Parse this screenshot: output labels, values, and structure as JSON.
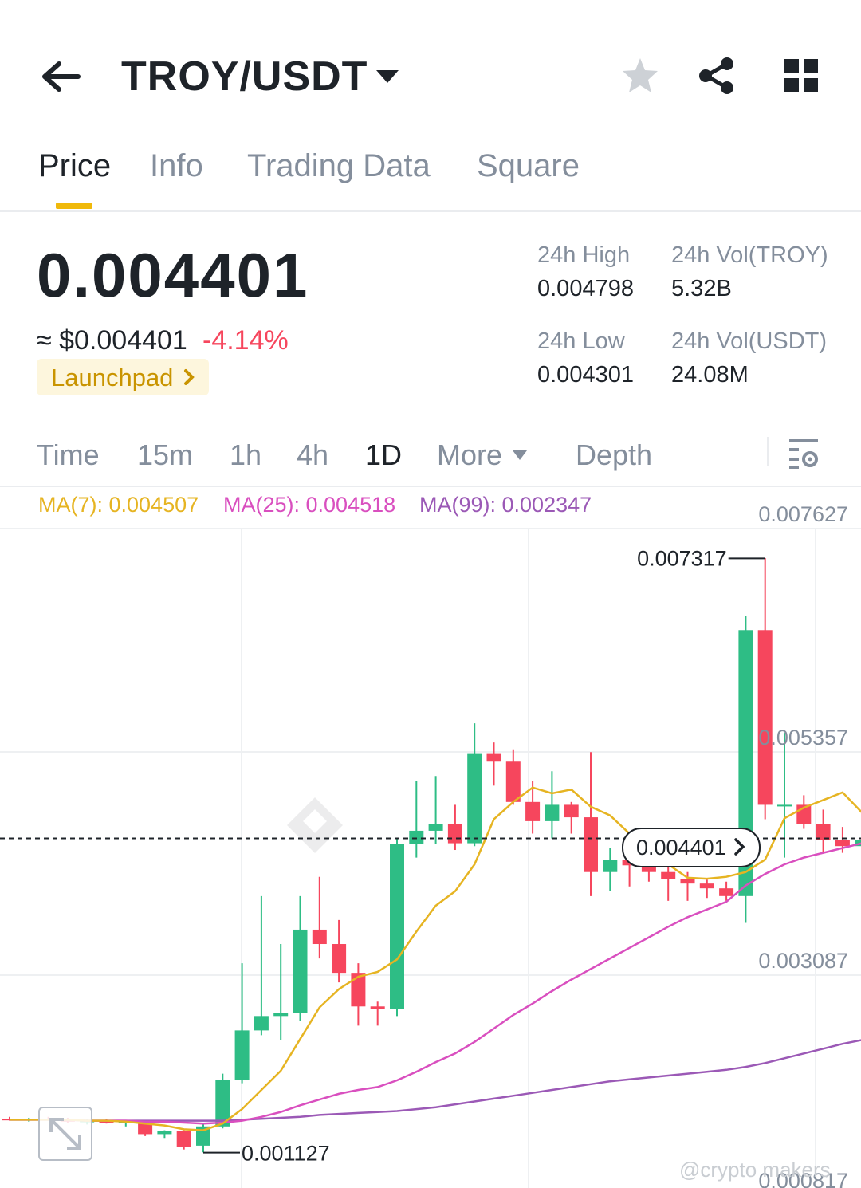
{
  "header": {
    "pair": "TROY/USDT",
    "icons": [
      "back-arrow-icon",
      "caret-down-icon",
      "star-icon",
      "share-icon",
      "grid-icon"
    ]
  },
  "tabs": [
    {
      "label": "Price",
      "active": true
    },
    {
      "label": "Info"
    },
    {
      "label": "Trading Data"
    },
    {
      "label": "Square"
    }
  ],
  "ticker": {
    "price": "0.004401",
    "approx": "≈ $0.004401",
    "change": "-4.14%",
    "badge": "Launchpad",
    "stats": [
      {
        "label": "24h High",
        "value": "0.004798"
      },
      {
        "label": "24h Vol(TROY)",
        "value": "5.32B"
      },
      {
        "label": "24h Low",
        "value": "0.004301"
      },
      {
        "label": "24h Vol(USDT)",
        "value": "24.08M"
      }
    ]
  },
  "intervals": [
    "Time",
    "15m",
    "1h",
    "4h",
    "1D",
    "More",
    "Depth"
  ],
  "active_interval": "1D",
  "ma": {
    "ma7": "MA(7): 0.004507",
    "ma25": "MA(25): 0.004518",
    "ma99": "MA(99): 0.002347"
  },
  "colors": {
    "up": "#2ebd85",
    "down": "#f6465d",
    "accent": "#f0b90b",
    "ma7": "#e6b422",
    "ma25": "#d94fbf",
    "ma99": "#9b59b6"
  },
  "chart_data": {
    "type": "candlestick",
    "interval": "1D",
    "y_axis_labels": [
      "0.007627",
      "0.005357",
      "0.003087",
      "0.000817"
    ],
    "ylim": [
      0.000817,
      0.007627
    ],
    "grid": true,
    "current_price_label": "0.004401",
    "high_annotation": "0.007317",
    "low_annotation": "0.001127",
    "candles": [
      {
        "o": 0.00148,
        "h": 0.0015,
        "l": 0.00146,
        "c": 0.00147
      },
      {
        "o": 0.00147,
        "h": 0.00149,
        "l": 0.00145,
        "c": 0.00148
      },
      {
        "o": 0.00148,
        "h": 0.0015,
        "l": 0.00146,
        "c": 0.00147
      },
      {
        "o": 0.00147,
        "h": 0.00149,
        "l": 0.00144,
        "c": 0.00145
      },
      {
        "o": 0.00145,
        "h": 0.00148,
        "l": 0.00142,
        "c": 0.00146
      },
      {
        "o": 0.00146,
        "h": 0.00148,
        "l": 0.00143,
        "c": 0.00144
      },
      {
        "o": 0.00144,
        "h": 0.00146,
        "l": 0.0014,
        "c": 0.00145
      },
      {
        "o": 0.00145,
        "h": 0.00146,
        "l": 0.0013,
        "c": 0.00132
      },
      {
        "o": 0.00132,
        "h": 0.00136,
        "l": 0.00128,
        "c": 0.00135
      },
      {
        "o": 0.00135,
        "h": 0.00136,
        "l": 0.00116,
        "c": 0.00119
      },
      {
        "o": 0.0012,
        "h": 0.00144,
        "l": 0.00113,
        "c": 0.0014
      },
      {
        "o": 0.0014,
        "h": 0.00195,
        "l": 0.00138,
        "c": 0.00188
      },
      {
        "o": 0.00188,
        "h": 0.0031,
        "l": 0.00185,
        "c": 0.0024
      },
      {
        "o": 0.0024,
        "h": 0.0038,
        "l": 0.00235,
        "c": 0.00255
      },
      {
        "o": 0.00255,
        "h": 0.0033,
        "l": 0.0023,
        "c": 0.00258
      },
      {
        "o": 0.00258,
        "h": 0.0038,
        "l": 0.0025,
        "c": 0.00345
      },
      {
        "o": 0.00345,
        "h": 0.004,
        "l": 0.00315,
        "c": 0.0033
      },
      {
        "o": 0.0033,
        "h": 0.00355,
        "l": 0.0029,
        "c": 0.003
      },
      {
        "o": 0.003,
        "h": 0.0031,
        "l": 0.00245,
        "c": 0.00265
      },
      {
        "o": 0.00265,
        "h": 0.0027,
        "l": 0.00245,
        "c": 0.00262
      },
      {
        "o": 0.00262,
        "h": 0.0044,
        "l": 0.00255,
        "c": 0.00434
      },
      {
        "o": 0.00434,
        "h": 0.005,
        "l": 0.0042,
        "c": 0.00448
      },
      {
        "o": 0.00448,
        "h": 0.00505,
        "l": 0.00434,
        "c": 0.00455
      },
      {
        "o": 0.00455,
        "h": 0.00475,
        "l": 0.00428,
        "c": 0.00435
      },
      {
        "o": 0.00435,
        "h": 0.0056,
        "l": 0.00432,
        "c": 0.00528
      },
      {
        "o": 0.00528,
        "h": 0.0054,
        "l": 0.00495,
        "c": 0.0052
      },
      {
        "o": 0.0052,
        "h": 0.00532,
        "l": 0.00475,
        "c": 0.00478
      },
      {
        "o": 0.00478,
        "h": 0.005,
        "l": 0.00445,
        "c": 0.00458
      },
      {
        "o": 0.00458,
        "h": 0.0051,
        "l": 0.0044,
        "c": 0.00475
      },
      {
        "o": 0.00475,
        "h": 0.00478,
        "l": 0.00445,
        "c": 0.00462
      },
      {
        "o": 0.00462,
        "h": 0.0053,
        "l": 0.0038,
        "c": 0.00405
      },
      {
        "o": 0.00405,
        "h": 0.0043,
        "l": 0.00385,
        "c": 0.00418
      },
      {
        "o": 0.00418,
        "h": 0.0044,
        "l": 0.0039,
        "c": 0.00412
      },
      {
        "o": 0.00412,
        "h": 0.00418,
        "l": 0.00395,
        "c": 0.00405
      },
      {
        "o": 0.00405,
        "h": 0.0041,
        "l": 0.00375,
        "c": 0.00398
      },
      {
        "o": 0.00398,
        "h": 0.00405,
        "l": 0.00375,
        "c": 0.00393
      },
      {
        "o": 0.00393,
        "h": 0.00397,
        "l": 0.00378,
        "c": 0.00388
      },
      {
        "o": 0.00388,
        "h": 0.00395,
        "l": 0.00375,
        "c": 0.0038
      },
      {
        "o": 0.0038,
        "h": 0.00672,
        "l": 0.00352,
        "c": 0.00657
      },
      {
        "o": 0.00657,
        "h": 0.00732,
        "l": 0.0046,
        "c": 0.00475
      },
      {
        "o": 0.00475,
        "h": 0.0055,
        "l": 0.0042,
        "c": 0.00475
      },
      {
        "o": 0.00475,
        "h": 0.00485,
        "l": 0.0045,
        "c": 0.00455
      },
      {
        "o": 0.00455,
        "h": 0.0047,
        "l": 0.00425,
        "c": 0.00438
      },
      {
        "o": 0.00438,
        "h": 0.00452,
        "l": 0.00425,
        "c": 0.00432
      },
      {
        "o": 0.00432,
        "h": 0.00446,
        "l": 0.00428,
        "c": 0.00438
      },
      {
        "o": 0.00438,
        "h": 0.00447,
        "l": 0.00428,
        "c": 0.0044
      }
    ],
    "ma7": [
      0.00147,
      0.00147,
      0.00147,
      0.00147,
      0.00146,
      0.00146,
      0.00145,
      0.00143,
      0.00141,
      0.00137,
      0.00136,
      0.00143,
      0.00158,
      0.00178,
      0.00198,
      0.00231,
      0.00264,
      0.00283,
      0.00296,
      0.00301,
      0.00314,
      0.00343,
      0.0037,
      0.00385,
      0.00413,
      0.0046,
      0.00478,
      0.00493,
      0.00487,
      0.00491,
      0.00473,
      0.00464,
      0.00445,
      0.00431,
      0.00413,
      0.00399,
      0.00398,
      0.004,
      0.00405,
      0.00418,
      0.00461,
      0.00472,
      0.0048,
      0.00488,
      0.00467,
      0.00455
    ],
    "ma25": [
      0.00147,
      0.00147,
      0.00147,
      0.00147,
      0.00146,
      0.00146,
      0.00146,
      0.00145,
      0.00145,
      0.00144,
      0.00143,
      0.00144,
      0.00146,
      0.0015,
      0.00155,
      0.00162,
      0.00168,
      0.00174,
      0.00178,
      0.00181,
      0.00188,
      0.00197,
      0.00207,
      0.00216,
      0.00228,
      0.00242,
      0.00256,
      0.00268,
      0.00281,
      0.00293,
      0.00304,
      0.00315,
      0.00326,
      0.00337,
      0.00348,
      0.00358,
      0.00366,
      0.00374,
      0.00391,
      0.00403,
      0.00413,
      0.0042,
      0.00425,
      0.0043,
      0.00435,
      0.0044
    ],
    "ma99": [
      0.00147,
      0.00147,
      0.00147,
      0.00147,
      0.00146,
      0.00146,
      0.00146,
      0.00146,
      0.00146,
      0.00146,
      0.00146,
      0.00146,
      0.00147,
      0.00148,
      0.00149,
      0.0015,
      0.00152,
      0.00153,
      0.00154,
      0.00155,
      0.00156,
      0.00158,
      0.0016,
      0.00163,
      0.00166,
      0.00169,
      0.00172,
      0.00175,
      0.00178,
      0.00181,
      0.00184,
      0.00187,
      0.00189,
      0.00191,
      0.00193,
      0.00195,
      0.00197,
      0.00199,
      0.00202,
      0.00206,
      0.00211,
      0.00216,
      0.00221,
      0.00226,
      0.0023,
      0.00235
    ]
  },
  "watermark": "@crypto makers"
}
